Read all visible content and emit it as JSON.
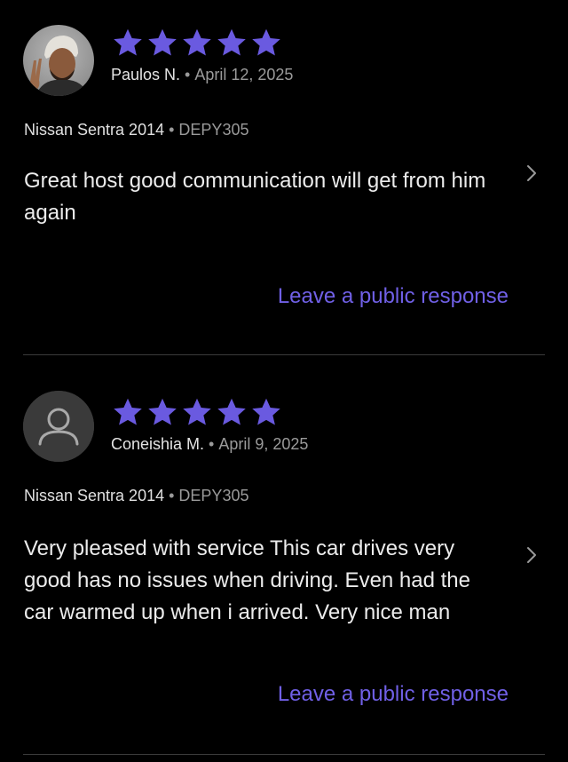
{
  "theme": {
    "background": "#000000",
    "star_color": "#6a5ae0",
    "link_color": "#7060e6"
  },
  "reviews": [
    {
      "avatar": "user-photo-avatar",
      "rating": 5,
      "reviewer": "Paulos N.",
      "separator": "•",
      "date": "April 12, 2025",
      "vehicle": "Nissan Sentra 2014",
      "plate": "DEPY305",
      "text": "Great host good communication will get from him again",
      "action": "Leave a public response"
    },
    {
      "avatar": "default-user-avatar",
      "rating": 5,
      "reviewer": "Coneishia M.",
      "separator": "•",
      "date": "April 9, 2025",
      "vehicle": "Nissan Sentra 2014",
      "plate": "DEPY305",
      "text": "Very pleased with service This car drives very good has no issues when driving. Even had the car warmed up when i arrived. Very nice man",
      "action": "Leave a public response"
    }
  ]
}
